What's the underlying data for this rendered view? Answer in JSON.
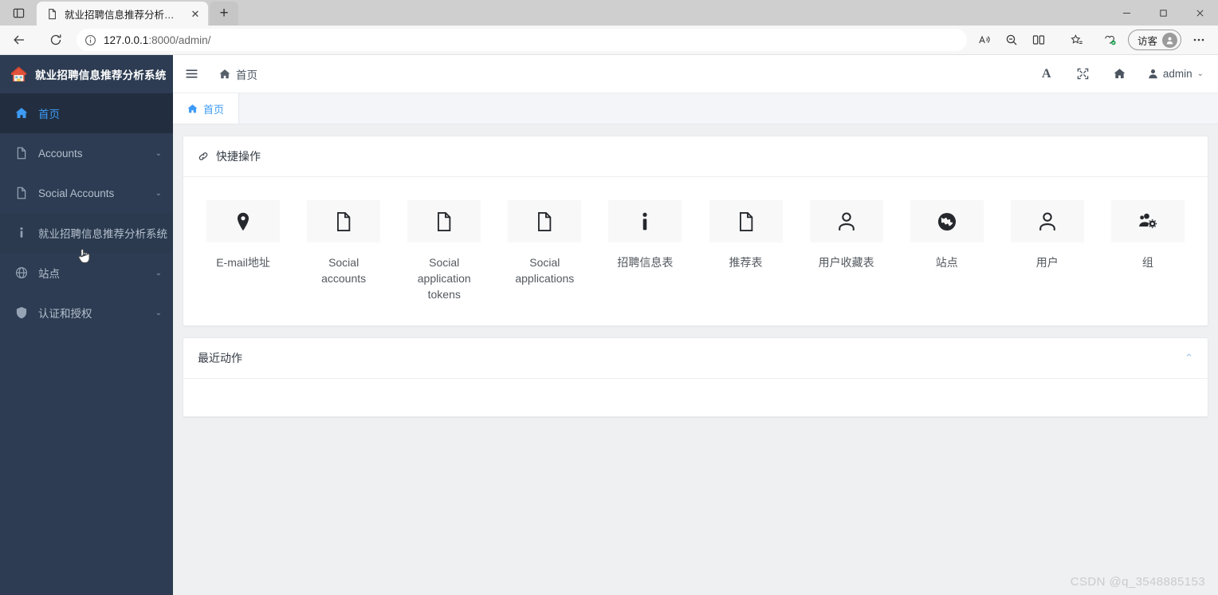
{
  "browser": {
    "tab": {
      "title": "就业招聘信息推荐分析系统",
      "close_label": "✕",
      "favicon": "page-icon"
    },
    "new_tab_label": "+",
    "window_controls": {
      "minimize": "minimize-icon",
      "maximize": "maximize-icon",
      "close": "close-icon"
    },
    "toolbar": {
      "back": "back-arrow-icon",
      "reload": "reload-icon",
      "info": "info-circle-icon",
      "url_host": "127.0.0.1",
      "url_rest": ":8000/admin/",
      "url_full": "127.0.0.1:8000/admin/",
      "read_aloud": "read-aloud-icon",
      "zoom_out": "zoom-out-icon",
      "split_screen": "split-screen-icon",
      "favorites": "favorites-add-icon",
      "collections": "collections-icon",
      "profile_label": "访客",
      "profile_avatar": "person-avatar-icon",
      "settings_more": "ellipsis-icon"
    }
  },
  "sidebar": {
    "brand": {
      "logo": "house-logo-icon",
      "title": "就业招聘信息推荐分析系统"
    },
    "items": [
      {
        "label": "首页",
        "icon": "home-icon",
        "active": true,
        "has_caret": false
      },
      {
        "label": "Accounts",
        "icon": "file-icon",
        "active": false,
        "has_caret": true,
        "caret": "⌄"
      },
      {
        "label": "Social Accounts",
        "icon": "file-icon",
        "active": false,
        "has_caret": true,
        "caret": "⌄"
      },
      {
        "label": "就业招聘信息推荐分析系统",
        "icon": "info-icon",
        "active": false,
        "has_caret": false,
        "hovered": true
      },
      {
        "label": "站点",
        "icon": "globe-icon",
        "active": false,
        "has_caret": true,
        "caret": "⌄"
      },
      {
        "label": "认证和授权",
        "icon": "shield-icon",
        "active": false,
        "has_caret": true,
        "caret": "⌄"
      }
    ]
  },
  "topbar": {
    "hamburger": "hamburger-icon",
    "home_crumb": {
      "icon": "home-icon",
      "label": "首页"
    },
    "actions": [
      {
        "name": "font-size-button",
        "glyph": "A"
      },
      {
        "name": "fullscreen-button",
        "glyph": "fullscreen-icon"
      },
      {
        "name": "home-button",
        "glyph": "home-icon"
      }
    ],
    "user": {
      "icon": "user-icon",
      "label": "admin",
      "caret": "⌄"
    }
  },
  "page_tabs": [
    {
      "label": "首页",
      "icon": "home-icon",
      "active": true
    }
  ],
  "quick_panel": {
    "icon": "link-icon",
    "title": "快捷操作",
    "items": [
      {
        "label": "E-mail地址",
        "icon": "map-pin-icon"
      },
      {
        "label": "Social accounts",
        "icon": "file-icon"
      },
      {
        "label": "Social application tokens",
        "icon": "file-icon"
      },
      {
        "label": "Social applications",
        "icon": "file-icon"
      },
      {
        "label": "招聘信息表",
        "icon": "info-bold-icon"
      },
      {
        "label": "推荐表",
        "icon": "file-icon"
      },
      {
        "label": "用户收藏表",
        "icon": "person-icon"
      },
      {
        "label": "站点",
        "icon": "globe-icon"
      },
      {
        "label": "用户",
        "icon": "person-icon"
      },
      {
        "label": "组",
        "icon": "group-settings-icon"
      }
    ]
  },
  "recent_panel": {
    "title": "最近动作",
    "collapse_caret": "⌃",
    "body_text": ""
  },
  "watermark": "CSDN @q_3548885153",
  "colors": {
    "sidebar_bg": "#2d3c52",
    "sidebar_active_bg": "#222e3f",
    "accent_blue": "#3d9bf7",
    "content_bg": "#eff0f2",
    "panel_bg": "#ffffff",
    "tile_bg": "#f8f8f9"
  }
}
